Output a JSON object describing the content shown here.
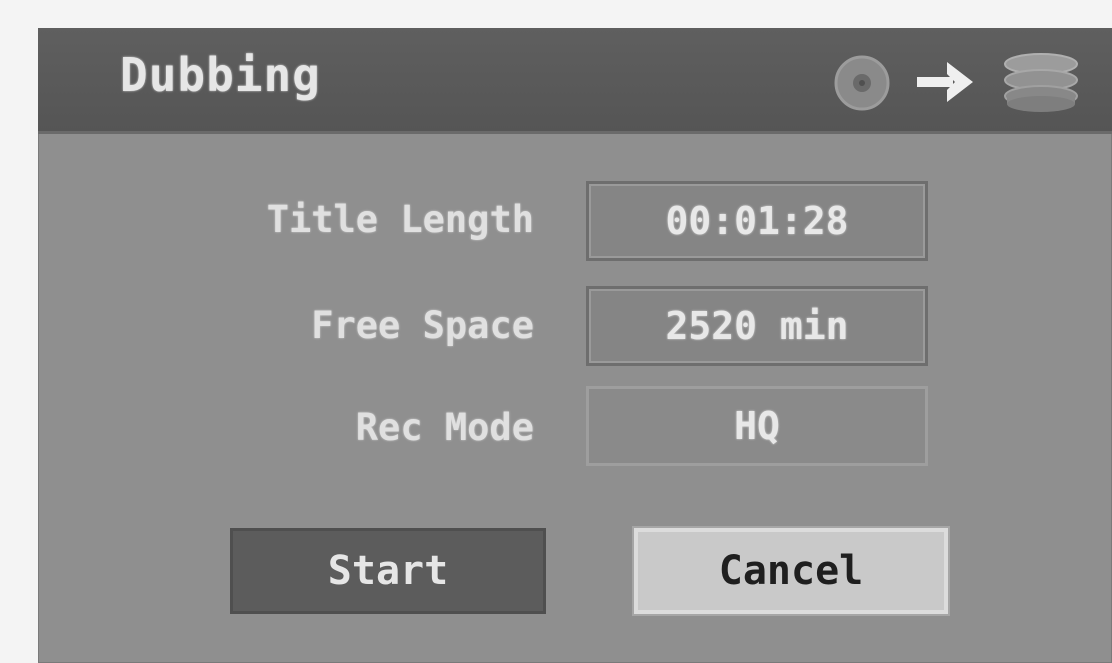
{
  "dialog": {
    "title": "Dubbing",
    "icons": [
      "disc-icon",
      "arrow-right-icon",
      "hard-disk-icon"
    ]
  },
  "fields": {
    "title_length": {
      "label": "Title Length",
      "value": "00:01:28"
    },
    "free_space": {
      "label": "Free Space",
      "value": "2520 min"
    },
    "rec_mode": {
      "label": "Rec Mode",
      "value": "HQ"
    }
  },
  "buttons": {
    "start_label": "Start",
    "cancel_label": "Cancel"
  },
  "colors": {
    "panel": "#8f8f8f",
    "titlebar": "#5a5a5a",
    "start_button": "#5c5c5c",
    "cancel_button_selected": "#c9c9c9"
  }
}
